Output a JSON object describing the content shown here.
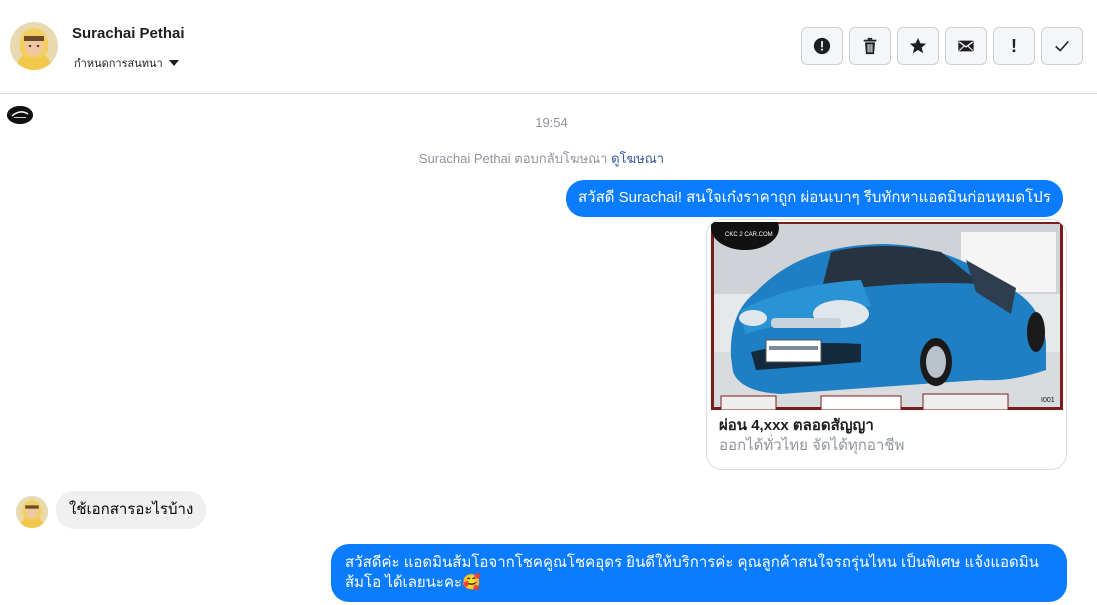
{
  "header": {
    "contact_name": "Surachai Pethai",
    "assign_label": "กำหนดการสนทนา",
    "actions": [
      {
        "icon": "alert-circle-icon",
        "name": "mark-spam-button"
      },
      {
        "icon": "trash-icon",
        "name": "delete-button"
      },
      {
        "icon": "star-icon",
        "name": "star-button"
      },
      {
        "icon": "envelope-icon",
        "name": "mark-unread-button"
      },
      {
        "icon": "exclamation-icon",
        "name": "follow-up-button"
      },
      {
        "icon": "check-icon",
        "name": "mark-done-button"
      }
    ],
    "follow_up_glyph": "!"
  },
  "conversation": {
    "timestamp": "19:54",
    "ad_reply_text": "Surachai Pethai ตอบกลับโฆษณา",
    "ad_reply_link": "ดูโฆษณา",
    "messages": [
      {
        "from": "page",
        "text": "สวัสดี Surachai! สนใจเก๋งราคาถูก ผ่อนเบาๆ รีบทักหาแอดมินก่อนหมดโปร"
      },
      {
        "from": "contact",
        "text": "ใช้เอกสารอะไรบ้าง"
      },
      {
        "from": "page",
        "text": "สวัสดีค่ะ แอดมินส้มโอจากโชคคูณโชคอุดร ยินดีให้บริการค่ะ   คุณลูกค้าสนใจรถรุ่นไหน เป็นพิเศษ แจ้งแอดมินส้มโอ ได้เลยนะคะ🥰"
      }
    ],
    "ad_card": {
      "title": "ผ่อน 4,xxx ตลอดสัญญา",
      "subtitle": "ออกได้ทั่วไทย จัดได้ทุกอาชีพ",
      "image_watermark": "CKC 2 CAR.COM",
      "image_code": "I001"
    }
  },
  "colors": {
    "outgoing_bubble": "#0a7cff",
    "incoming_bubble": "#f0f0f0",
    "meta_text": "#90949c",
    "link": "#365899",
    "car_body": "#1f7fc4"
  }
}
